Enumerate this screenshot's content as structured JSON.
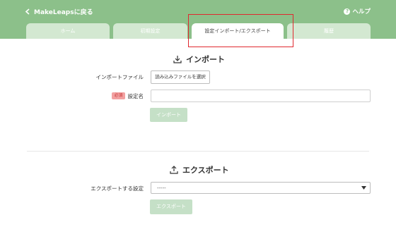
{
  "header": {
    "back_label": "MakeLeapsに戻る",
    "help_label": "ヘルプ",
    "background_color": "#8cc08a"
  },
  "tabs": [
    {
      "label": "ホーム",
      "active": false
    },
    {
      "label": "初期設定",
      "active": false
    },
    {
      "label": "設定インポート/エクスポート",
      "active": true
    },
    {
      "label": "履歴",
      "active": false
    }
  ],
  "import_section": {
    "title": "インポート",
    "icon": "download-icon",
    "file_label": "インポートファイル",
    "file_button_label": "読み込みファイルを選択",
    "required_badge": "必須",
    "name_label": "設定名",
    "name_value": "",
    "submit_label": "インポート"
  },
  "export_section": {
    "title": "エクスポート",
    "icon": "upload-icon",
    "setting_label": "エクスポートする設定",
    "selected_value": "-----",
    "submit_label": "エクスポート"
  },
  "colors": {
    "accent": "#8cc08a",
    "disabled_button": "#c5e0c7",
    "highlight": "#e0282f",
    "required_badge": "#f2a1a1"
  }
}
